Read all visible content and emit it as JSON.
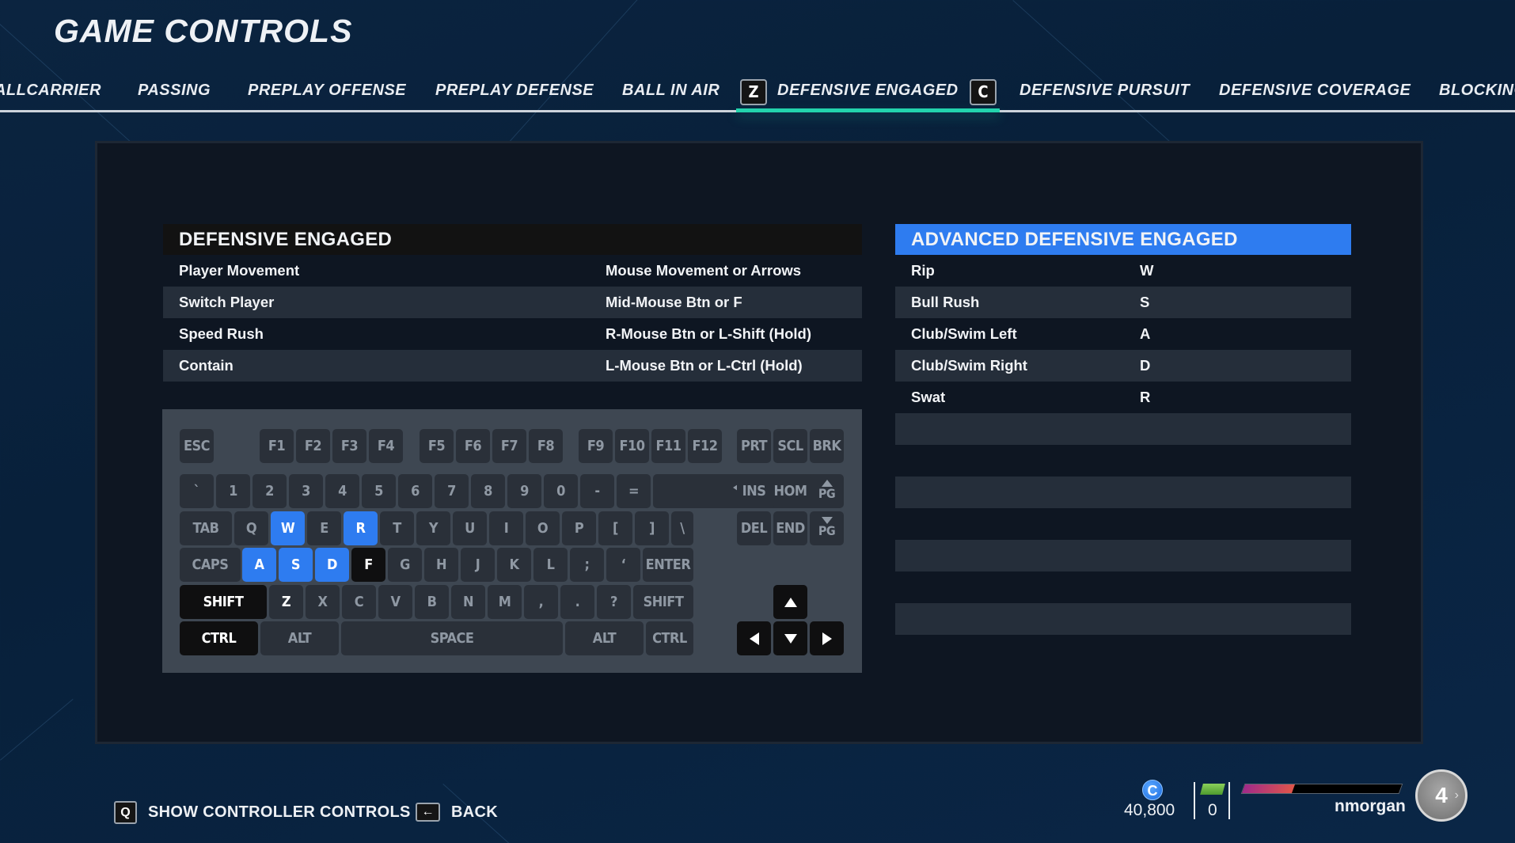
{
  "header": {
    "title": "GAME CONTROLS"
  },
  "tabs": {
    "items": [
      {
        "label": "BALLCARRIER",
        "active": false
      },
      {
        "label": "PASSING",
        "active": false
      },
      {
        "label": "PREPLAY OFFENSE",
        "active": false
      },
      {
        "label": "PREPLAY DEFENSE",
        "active": false
      },
      {
        "label": "BALL IN AIR",
        "active": false
      },
      {
        "label": "DEFENSIVE ENGAGED",
        "active": true
      },
      {
        "label": "DEFENSIVE PURSUIT",
        "active": false
      },
      {
        "label": "DEFENSIVE COVERAGE",
        "active": false
      },
      {
        "label": "BLOCKING",
        "active": false
      }
    ],
    "prev_key": "Z",
    "next_key": "C",
    "active_color": "#23d3ad"
  },
  "basic_controls": {
    "title": "DEFENSIVE ENGAGED",
    "rows": [
      {
        "action": "Player Movement",
        "binding": "Mouse Movement or Arrows"
      },
      {
        "action": "Switch Player",
        "binding": "Mid-Mouse Btn or F"
      },
      {
        "action": "Speed Rush",
        "binding": "R-Mouse Btn or L-Shift (Hold)"
      },
      {
        "action": "Contain",
        "binding": "L-Mouse Btn or L-Ctrl (Hold)"
      }
    ]
  },
  "advanced_controls": {
    "title": "ADVANCED DEFENSIVE ENGAGED",
    "accent_color": "#2e7cf0",
    "rows": [
      {
        "action": "Rip",
        "binding": "W"
      },
      {
        "action": "Bull Rush",
        "binding": "S"
      },
      {
        "action": "Club/Swim Left",
        "binding": "A"
      },
      {
        "action": "Club/Swim Right",
        "binding": "D"
      },
      {
        "action": "Swat",
        "binding": "R"
      },
      {
        "action": "",
        "binding": ""
      },
      {
        "action": "",
        "binding": ""
      },
      {
        "action": "",
        "binding": ""
      },
      {
        "action": "",
        "binding": ""
      },
      {
        "action": "",
        "binding": ""
      },
      {
        "action": "",
        "binding": ""
      },
      {
        "action": "",
        "binding": ""
      },
      {
        "action": "",
        "binding": ""
      },
      {
        "action": "",
        "binding": ""
      },
      {
        "action": "",
        "binding": ""
      }
    ]
  },
  "keyboard": {
    "highlight_blue": [
      "W",
      "R",
      "A",
      "S",
      "D"
    ],
    "highlight_black": [
      "F",
      "L-SHIFT",
      "L-CTRL",
      "UP",
      "LEFT",
      "DOWN",
      "RIGHT"
    ],
    "keys": {
      "esc": "ESC",
      "f1": "F1",
      "f2": "F2",
      "f3": "F3",
      "f4": "F4",
      "f5": "F5",
      "f6": "F6",
      "f7": "F7",
      "f8": "F8",
      "f9": "F9",
      "f10": "F10",
      "f11": "F11",
      "f12": "F12",
      "prt": "PRT",
      "scl": "SCL",
      "brk": "BRK",
      "grave": "`",
      "n1": "1",
      "n2": "2",
      "n3": "3",
      "n4": "4",
      "n5": "5",
      "n6": "6",
      "n7": "7",
      "n8": "8",
      "n9": "9",
      "n0": "0",
      "minus": "-",
      "equals": "=",
      "ins": "INS",
      "hom": "HOM",
      "pg": "PG",
      "tab": "TAB",
      "q": "Q",
      "w": "W",
      "e": "E",
      "r": "R",
      "t": "T",
      "y": "Y",
      "u": "U",
      "i": "I",
      "o": "O",
      "p": "P",
      "lbr": "[",
      "rbr": "]",
      "bslash": "\\",
      "del": "DEL",
      "end": "END",
      "caps": "CAPS",
      "a": "A",
      "s": "S",
      "d": "D",
      "f": "F",
      "g": "G",
      "h": "H",
      "j": "J",
      "k": "K",
      "l": "L",
      "semi": ";",
      "quote": "‘",
      "enter": "ENTER",
      "shift": "SHIFT",
      "z": "Z",
      "x": "X",
      "c": "C",
      "v": "V",
      "b": "B",
      "n": "N",
      "m": "M",
      "comma": ",",
      "period": ".",
      "slash": "?",
      "ctrl": "CTRL",
      "alt": "ALT",
      "space": "SPACE"
    }
  },
  "footer": {
    "show_controller": {
      "key": "Q",
      "label": "SHOW CONTROLLER CONTROLS"
    },
    "back": {
      "key": "←",
      "label": "BACK"
    }
  },
  "profile": {
    "coins_icon": "C",
    "coins": "40,800",
    "cash": "0",
    "xp_progress": 0.32,
    "username": "nmorgan",
    "level": "4"
  }
}
